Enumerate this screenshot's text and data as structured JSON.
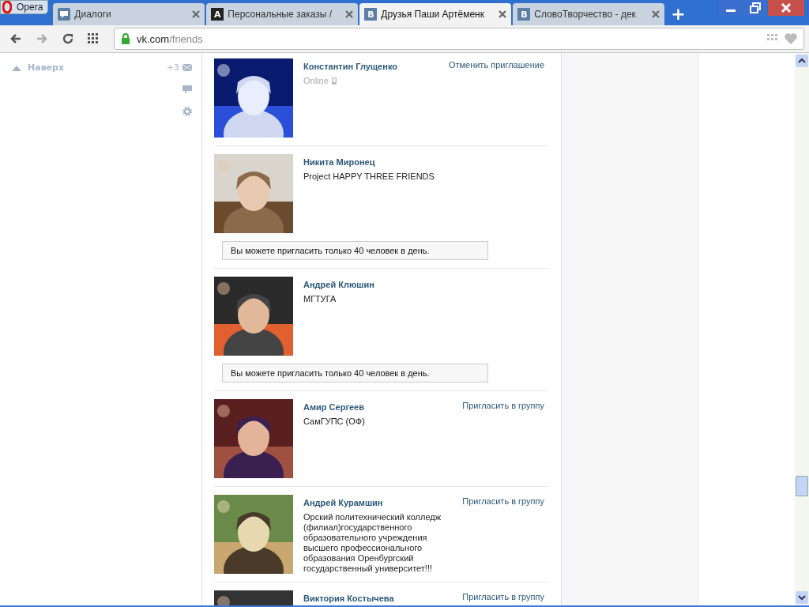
{
  "browser": {
    "menu_button": "Opera",
    "tabs": [
      {
        "title": "Диалоги",
        "kind": "chat",
        "selected": false
      },
      {
        "title": "Персональные заказы /",
        "kind": "letter",
        "icon_text": "A",
        "selected": false
      },
      {
        "title": "Друзья Паши Артёменк",
        "kind": "vk",
        "icon_text": "В",
        "selected": true
      },
      {
        "title": "СловоТворчество - дек",
        "kind": "vk",
        "icon_text": "В",
        "selected": false
      }
    ],
    "new_tab": "+",
    "address": {
      "host": "vk.com",
      "path": "/friends"
    }
  },
  "sidebar": {
    "back_to_top": "Наверх",
    "message_count": "+3"
  },
  "friends": [
    {
      "name": "Константин Глущенко",
      "kind": "online",
      "status": "Online",
      "online_mobile": true,
      "action": "Отменить приглашение"
    },
    {
      "name": "Никита Миронец",
      "kind": "text",
      "status": "Project HAPPY THREE FRIENDS",
      "notice": "Вы можете пригласить только 40 человек в день."
    },
    {
      "name": "Андрей Клюшин",
      "kind": "text",
      "status": "МГТУГА",
      "notice": "Вы можете пригласить только 40 человек в день."
    },
    {
      "name": "Амир Сергеев",
      "kind": "text",
      "status": "СамГУПС (ОФ)",
      "action": "Пригласить в группу"
    },
    {
      "name": "Андрей Курамшин",
      "kind": "text",
      "status": "Орский политехнический колледж (филиал)государственного образовательного учреждения высшего профессионального образования Оренбургский государственный университет!!!",
      "action": "Пригласить в группу"
    },
    {
      "name": "Виктория Костычева",
      "kind": "text",
      "action": "Пригласить в группу"
    }
  ]
}
